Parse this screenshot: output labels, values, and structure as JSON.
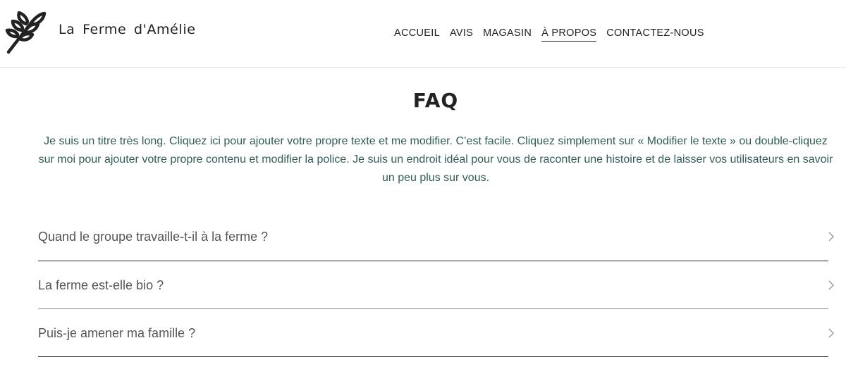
{
  "header": {
    "logo_icon": "leaf-branch-icon",
    "brand": "La Ferme d'Amélie",
    "nav": [
      {
        "label": "ACCUEIL",
        "active": false
      },
      {
        "label": "AVIS",
        "active": false
      },
      {
        "label": "MAGASIN",
        "active": false
      },
      {
        "label": "À PROPOS",
        "active": true
      },
      {
        "label": "CONTACTEZ-NOUS",
        "active": false
      }
    ]
  },
  "main": {
    "title": "FAQ",
    "intro": "Je suis un titre très long. Cliquez ici pour ajouter votre propre texte et me modifier. C’est facile. Cliquez simplement sur « Modifier le texte » ou double-cliquez sur moi pour ajouter votre propre contenu et modifier la police. Je suis un endroit idéal pour vous de raconter une histoire et de laisser vos utilisateurs en savoir un peu plus sur vous.",
    "faq": [
      {
        "question": "Quand le groupe travaille-t-il à la ferme ?",
        "icon": "chevron-right-icon"
      },
      {
        "question": "La ferme est-elle bio ?",
        "icon": "chevron-right-icon"
      },
      {
        "question": "Puis-je amener ma famille ?",
        "icon": "chevron-right-icon"
      }
    ]
  },
  "colors": {
    "text": "#222222",
    "intro_text": "#2f5e56",
    "question_text": "#555555",
    "divider": "#2a2a2a"
  }
}
